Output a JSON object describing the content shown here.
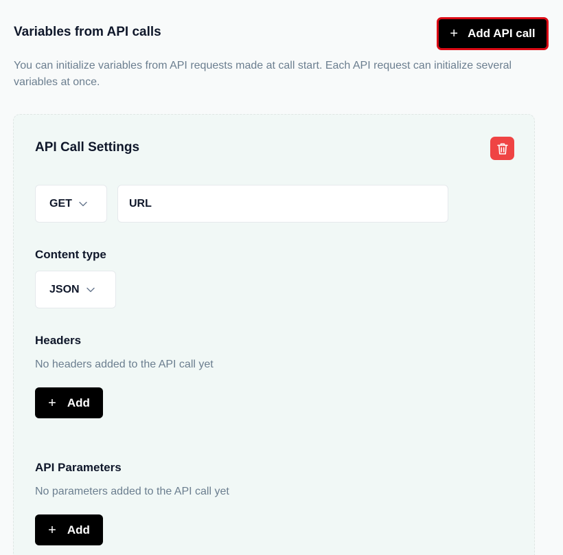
{
  "header": {
    "title": "Variables from API calls",
    "add_api_call_label": "Add API call",
    "description": "You can initialize variables from API requests made at call start. Each API request can initialize several variables at once."
  },
  "card": {
    "title": "API Call Settings",
    "method": {
      "selected": "GET"
    },
    "url": {
      "value": "",
      "placeholder": "URL"
    },
    "content_type": {
      "label": "Content type",
      "selected": "JSON"
    },
    "headers": {
      "label": "Headers",
      "empty_text": "No headers added to the API call yet",
      "add_label": "Add"
    },
    "parameters": {
      "label": "API Parameters",
      "empty_text": "No parameters added to the API call yet",
      "add_label": "Add"
    }
  },
  "icons": {
    "plus": "plus-icon",
    "chevron": "chevron-down-icon",
    "delete": "trash-icon"
  },
  "colors": {
    "primary_button": "#000000",
    "highlight_border": "#dc0a14",
    "delete_button": "#ef4444",
    "card_background": "#f1f8f6",
    "muted_text": "#6b7e8f"
  }
}
